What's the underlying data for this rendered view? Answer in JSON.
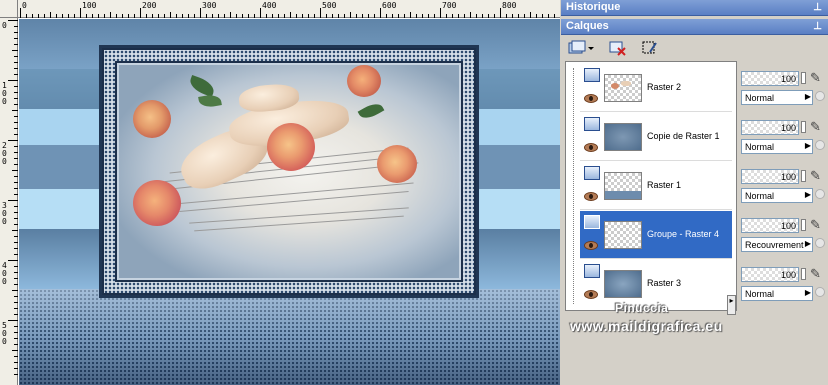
{
  "ruler": {
    "top_labels": [
      "0",
      "100",
      "200",
      "300",
      "400",
      "500",
      "600",
      "700",
      "800"
    ],
    "left_labels": [
      "0",
      "1\n0\n0",
      "2\n0\n0",
      "3\n0\n0",
      "4\n0\n0",
      "5\n0\n0"
    ]
  },
  "panels": {
    "history_title": "Historique",
    "layers_title": "Calques"
  },
  "toolbar": {
    "icons": [
      "new-layer-icon",
      "delete-layer-icon",
      "layer-mask-icon"
    ]
  },
  "layers": [
    {
      "name": "Raster 2",
      "opacity": "100",
      "blend": "Normal",
      "selected": false
    },
    {
      "name": "Copie de Raster 1",
      "opacity": "100",
      "blend": "Normal",
      "selected": false
    },
    {
      "name": "Raster 1",
      "opacity": "100",
      "blend": "Normal",
      "selected": false
    },
    {
      "name": "Groupe - Raster 4",
      "opacity": "100",
      "blend": "Recouvrement",
      "selected": true
    },
    {
      "name": "Raster 3",
      "opacity": "100",
      "blend": "Normal",
      "selected": false
    }
  ],
  "watermark": {
    "line1": "Pinuccia",
    "line2": "www.maildigrafica.eu"
  },
  "colors": {
    "panel_header": "#5a7fc4",
    "selected_row": "#316ac5"
  }
}
